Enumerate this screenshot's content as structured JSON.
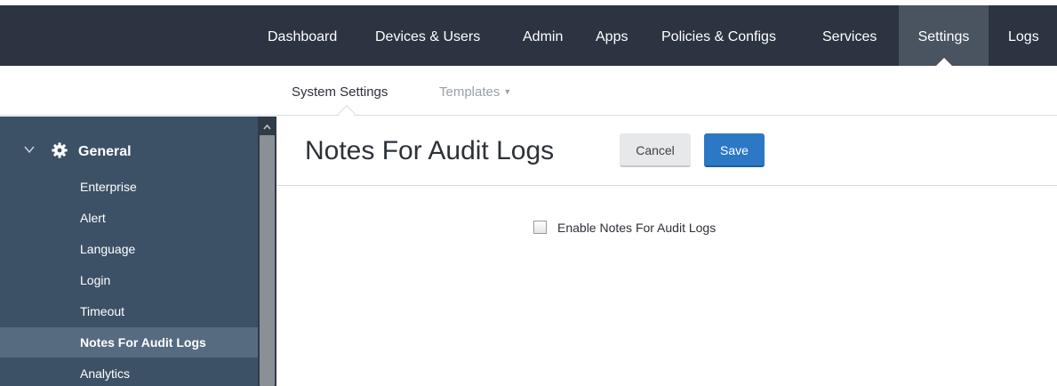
{
  "topnav": {
    "items": [
      {
        "label": "Dashboard"
      },
      {
        "label": "Devices & Users"
      },
      {
        "label": "Admin"
      },
      {
        "label": "Apps"
      },
      {
        "label": "Policies & Configs"
      },
      {
        "label": "Services"
      },
      {
        "label": "Settings",
        "active": true
      },
      {
        "label": "Logs"
      }
    ]
  },
  "subnav": {
    "items": [
      {
        "label": "System Settings",
        "active": true
      },
      {
        "label": "Templates",
        "dropdown": true
      }
    ]
  },
  "sidebar": {
    "section": {
      "label": "General",
      "icon": "gear-icon",
      "expanded": true
    },
    "items": [
      {
        "label": "Enterprise"
      },
      {
        "label": "Alert"
      },
      {
        "label": "Language"
      },
      {
        "label": "Login"
      },
      {
        "label": "Timeout"
      },
      {
        "label": "Notes For Audit Logs",
        "active": true
      },
      {
        "label": "Analytics"
      }
    ]
  },
  "page": {
    "title": "Notes For Audit Logs",
    "cancel_label": "Cancel",
    "save_label": "Save",
    "enable_checkbox": {
      "label": "Enable Notes For Audit Logs",
      "checked": false
    }
  },
  "colors": {
    "topnav_bg": "#2b3440",
    "topnav_active_bg": "#4a5360",
    "sidebar_bg": "#3c5166",
    "sidebar_active_bg": "#566b80",
    "save_button": "#2c78c5"
  }
}
